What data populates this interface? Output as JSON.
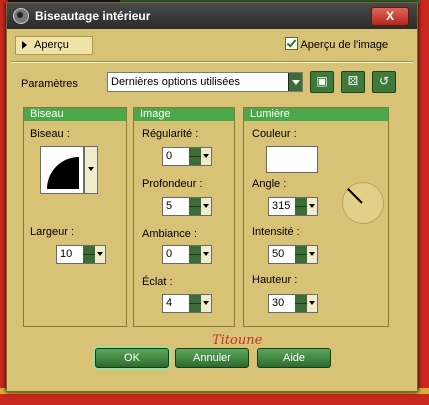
{
  "window": {
    "title": "Biseautage intérieur",
    "close_label": "X"
  },
  "preview": {
    "button_label": "Aperçu",
    "checkbox_label": "Aperçu de l'image",
    "checked": true
  },
  "settings": {
    "label": "Paramètres",
    "preset_value": "Dernières options utilisées"
  },
  "bevel": {
    "header": "Biseau",
    "bevel_label": "Biseau :",
    "width_label": "Largeur :",
    "width_value": "10"
  },
  "image": {
    "header": "Image",
    "regularity_label": "Régularité :",
    "regularity_value": "0",
    "depth_label": "Profondeur :",
    "depth_value": "5",
    "ambience_label": "Ambiance :",
    "ambience_value": "0",
    "shine_label": "Éclat :",
    "shine_value": "4"
  },
  "light": {
    "header": "Lumière",
    "color_label": "Couleur :",
    "color_value": "#ffffff",
    "angle_label": "Angle :",
    "angle_value": "315",
    "intensity_label": "Intensité :",
    "intensity_value": "50",
    "height_label": "Hauteur :",
    "height_value": "30"
  },
  "buttons": {
    "ok": "OK",
    "cancel": "Annuler",
    "help": "Aide"
  },
  "signature": "Titoune",
  "colors": {
    "dialog_bg": "#d8c276",
    "group_header": "#4aa84a",
    "button_green": "#3e7a3a",
    "close_red": "#c8281e"
  }
}
